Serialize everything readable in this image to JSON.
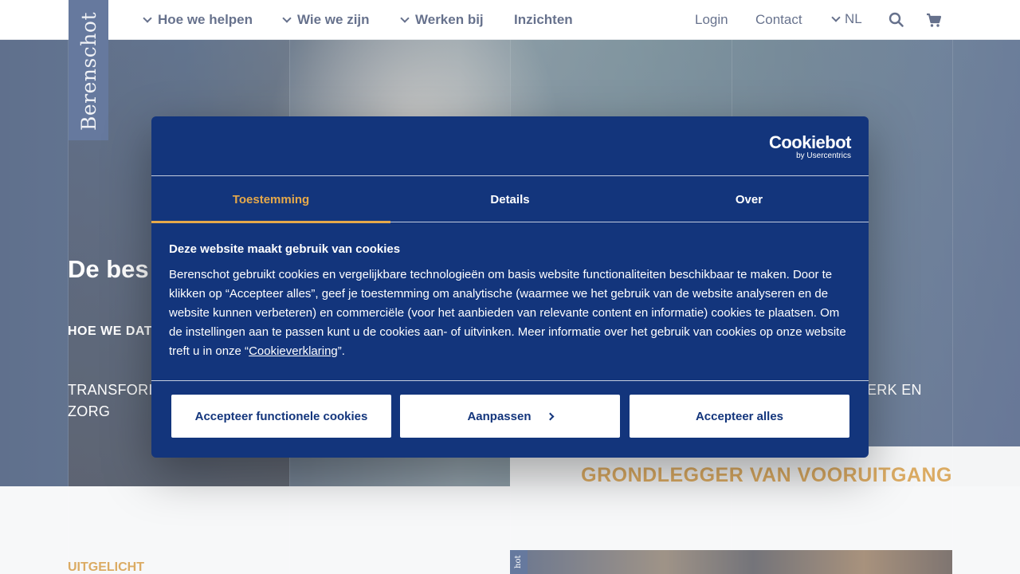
{
  "brand": {
    "logo_text": "Berenschot"
  },
  "nav": {
    "items": [
      {
        "label": "Hoe we helpen",
        "has_dropdown": true
      },
      {
        "label": "Wie we zijn",
        "has_dropdown": true
      },
      {
        "label": "Werken bij",
        "has_dropdown": true
      },
      {
        "label": "Inzichten",
        "has_dropdown": false
      }
    ],
    "login": "Login",
    "contact": "Contact",
    "language": "NL",
    "search_icon": "search-icon",
    "cart_icon": "cart-icon"
  },
  "hero": {
    "title": "De bes voor ie",
    "subtitle": "HOE WE DAT",
    "topics_left": "TRANSFORI",
    "topics_left_line2": "ZORG",
    "topics_right": "ERK EN"
  },
  "section": {
    "headline": "GRONDLEGGER VAN VOORUITGANG",
    "featured_label": "UITGELICHT",
    "mini_logo": "hot"
  },
  "cookie_dialog": {
    "brand_name": "Cookiebot",
    "brand_by": "by Usercentrics",
    "tabs": [
      {
        "label": "Toestemming",
        "active": true
      },
      {
        "label": "Details",
        "active": false
      },
      {
        "label": "Over",
        "active": false
      }
    ],
    "heading": "Deze website maakt gebruik van cookies",
    "body_text": "Berenschot gebruikt cookies en vergelijkbare technologieën om basis website functionaliteiten beschikbaar te maken. Door te klikken op “Accepteer alles”, geef je toestemming om analytische (waarmee we het gebruik van de website analyseren en de website kunnen verbeteren) en commerciële (voor het aanbieden van relevante content en informatie) cookies te plaatsen. Om de instellingen aan te passen kunt u de cookies aan- of uitvinken. Meer informatie over het gebruik van cookies op onze website treft u in onze “",
    "link_text": "Cookieverklaring",
    "body_end": "”.",
    "buttons": {
      "functional": "Accepteer functionele cookies",
      "customize": "Aanpassen",
      "accept_all": "Accepteer alles"
    }
  },
  "colors": {
    "navy": "#13357c",
    "accent_orange": "#e6a94a",
    "headline_orange": "#c87e10",
    "nav_text": "#14254f"
  }
}
